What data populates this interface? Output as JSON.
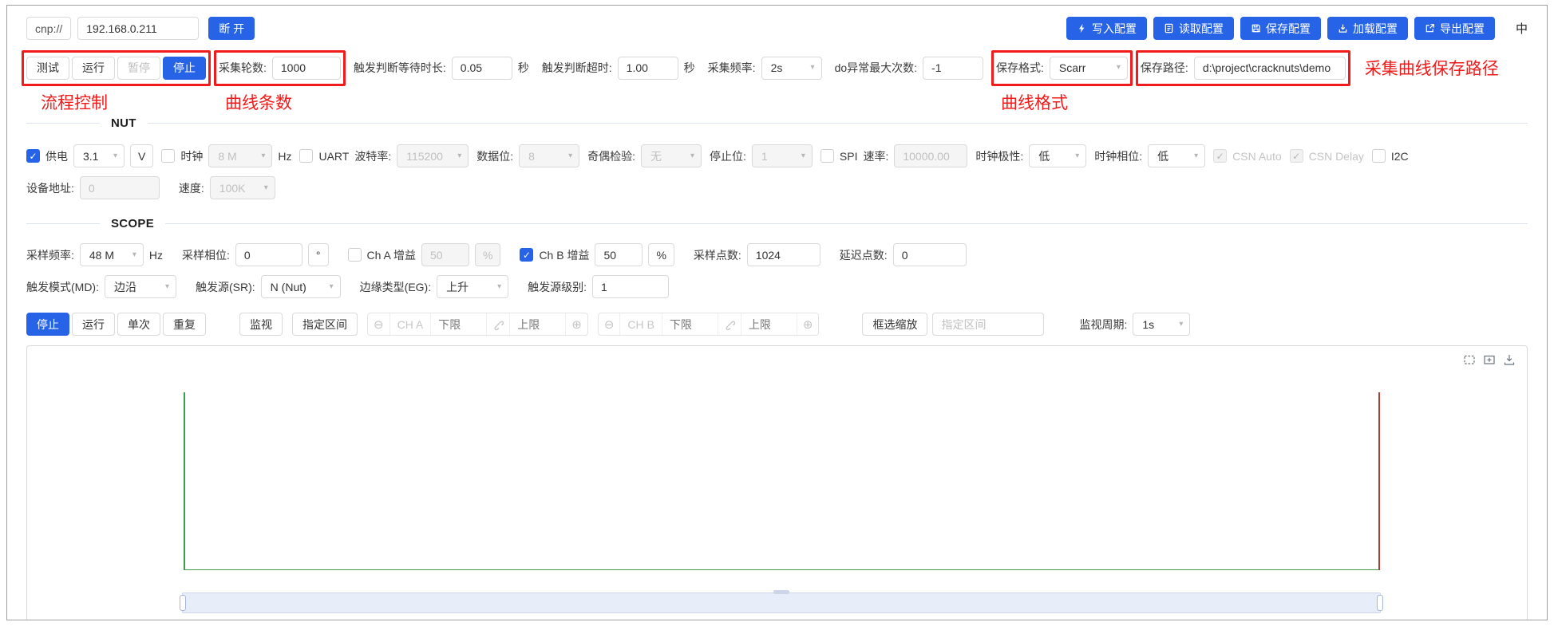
{
  "theme": {
    "accent_blue": "#2663e6",
    "annotation_red": "#f21b1b"
  },
  "header": {
    "protocol": "cnp://",
    "ip": "192.168.0.211",
    "disconnect_label": "断 开",
    "language": "中",
    "config_buttons": [
      {
        "label": "写入配置",
        "icon": "write-config-icon"
      },
      {
        "label": "读取配置",
        "icon": "read-config-icon"
      },
      {
        "label": "保存配置",
        "icon": "save-config-icon"
      },
      {
        "label": "加载配置",
        "icon": "load-config-icon"
      },
      {
        "label": "导出配置",
        "icon": "export-config-icon"
      }
    ]
  },
  "toolbar": {
    "flow": {
      "test": "测试",
      "run": "运行",
      "pause": "暂停",
      "stop": "停止"
    },
    "rounds": {
      "label": "采集轮数:",
      "value": "1000"
    },
    "trigger_wait": {
      "label": "触发判断等待时长:",
      "value": "0.05",
      "unit": "秒"
    },
    "trigger_timeout": {
      "label": "触发判断超时:",
      "value": "1.00",
      "unit": "秒"
    },
    "acq_freq": {
      "label": "采集频率:",
      "value": "2s"
    },
    "do_max_errors": {
      "label": "do异常最大次数:",
      "value": "-1"
    },
    "save_format": {
      "label": "保存格式:",
      "value": "Scarr"
    },
    "save_path": {
      "label": "保存路径:",
      "value": "d:\\project\\cracknuts\\demo"
    }
  },
  "annotations": {
    "flow_control": "流程控制",
    "curve_count": "曲线条数",
    "curve_format": "曲线格式",
    "save_path": "采集曲线保存路径"
  },
  "nut": {
    "title": "NUT",
    "power": {
      "label": "供电",
      "checked": true,
      "voltage": "3.1",
      "unit": "V"
    },
    "clock": {
      "label": "时钟",
      "checked": false,
      "value": "8 M",
      "unit": "Hz"
    },
    "uart": {
      "label": "UART",
      "checked": false,
      "baud_label": "波特率:",
      "baud": "115200",
      "data_bits_label": "数据位:",
      "data_bits": "8",
      "parity_label": "奇偶检验:",
      "parity": "无",
      "stop_bits_label": "停止位:",
      "stop_bits": "1"
    },
    "spi": {
      "label": "SPI",
      "checked": false,
      "rate_label": "速率:",
      "rate": "10000.00",
      "cpol_label": "时钟极性:",
      "cpol": "低",
      "cpha_label": "时钟相位:",
      "cpha": "低",
      "csn_auto_label": "CSN Auto",
      "csn_auto_checked": true,
      "csn_delay_label": "CSN Delay",
      "csn_delay_checked": true
    },
    "i2c": {
      "label": "I2C",
      "checked": false,
      "addr_label": "设备地址:",
      "addr": "0",
      "speed_label": "速度:",
      "speed": "100K"
    }
  },
  "scope": {
    "title": "SCOPE",
    "sample_freq": {
      "label": "采样频率:",
      "value": "48 M",
      "unit": "Hz"
    },
    "sample_phase": {
      "label": "采样相位:",
      "value": "0",
      "unit": "°"
    },
    "ch_a_gain": {
      "label": "Ch A 增益",
      "checked": false,
      "value": "50",
      "unit": "%"
    },
    "ch_b_gain": {
      "label": "Ch B 增益",
      "checked": true,
      "value": "50",
      "unit": "%"
    },
    "sample_points": {
      "label": "采样点数:",
      "value": "1024"
    },
    "delay_points": {
      "label": "延迟点数:",
      "value": "0"
    },
    "trigger_mode": {
      "label": "触发模式(MD):",
      "value": "边沿"
    },
    "trigger_source": {
      "label": "触发源(SR):",
      "value": "N (Nut)"
    },
    "edge_type": {
      "label": "边缘类型(EG):",
      "value": "上升"
    },
    "trigger_level": {
      "label": "触发源级别:",
      "value": "1"
    }
  },
  "controls": {
    "stop": "停止",
    "run": "运行",
    "single": "单次",
    "repeat": "重复",
    "monitor": "监视",
    "range_button": "指定区间",
    "ch_a": {
      "label": "CH A",
      "lower_placeholder": "下限",
      "upper_placeholder": "上限"
    },
    "ch_b": {
      "label": "CH B",
      "lower_placeholder": "下限",
      "upper_placeholder": "上限"
    },
    "box_zoom": "框选缩放",
    "range_input_placeholder": "指定区间",
    "monitor_period": {
      "label": "监视周期:",
      "value": "1s"
    }
  },
  "chart": {
    "trace_green": "#3f9b4f",
    "trace_red": "#b03a34"
  }
}
